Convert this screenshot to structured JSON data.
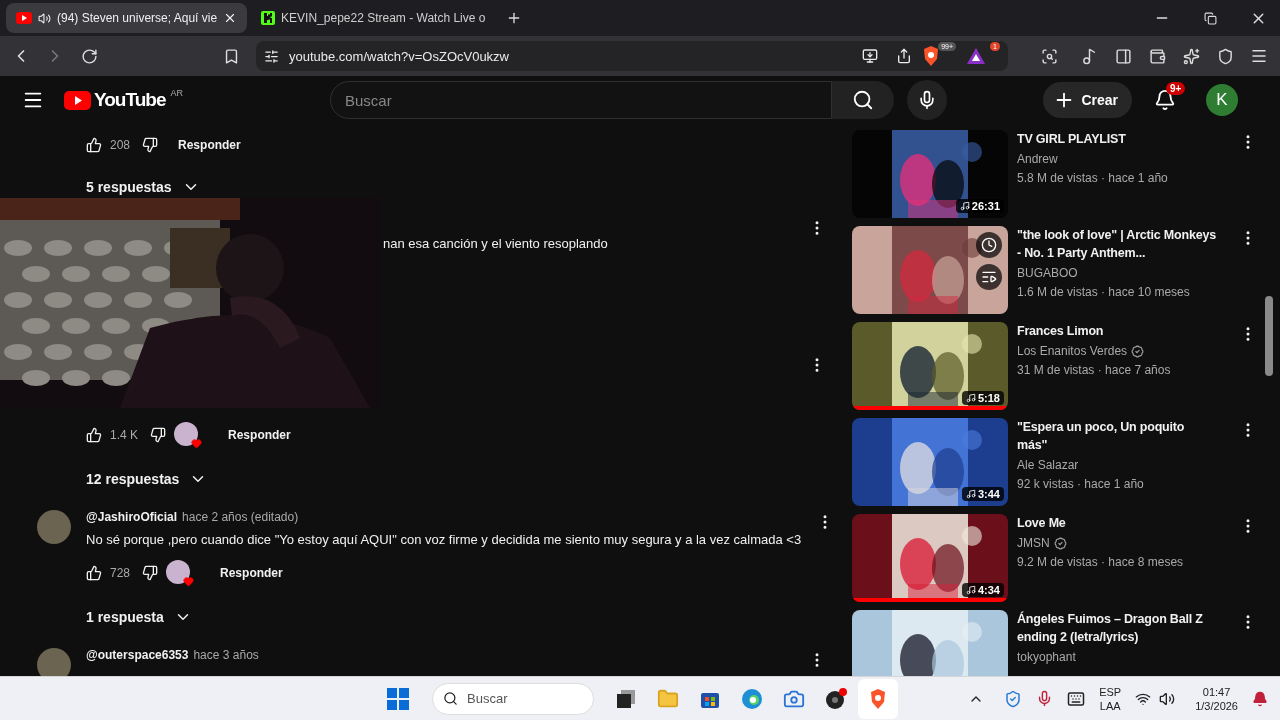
{
  "browser": {
    "tabs": [
      {
        "kind": "play",
        "title": "(94) Steven universe; Aquí vie",
        "selected": true,
        "audio": true
      },
      {
        "kind": "block",
        "title": "KEVIN_pepe22 Stream - Watch Live o",
        "selected": false,
        "audio": false
      }
    ],
    "url": "youtube.com/watch?v=OsZOcV0ukzw",
    "shield_badge": "99+",
    "rewards_badge": "1"
  },
  "header": {
    "logo_text": "YouTube",
    "region": "AR",
    "search_placeholder": "Buscar",
    "create_label": "Crear",
    "notification_count": "9+",
    "avatar_letter": "K"
  },
  "comments": [
    {
      "kind": "actions",
      "likes": "208",
      "creator_heart": false,
      "reply_label": "Responder"
    },
    {
      "kind": "replies",
      "label": "5 respuestas"
    },
    {
      "kind": "fragment",
      "text": "nan esa canción y el viento resoplando"
    },
    {
      "kind": "hidden"
    },
    {
      "kind": "actions",
      "likes": "1.4 K",
      "creator_heart": true,
      "reply_label": "Responder"
    },
    {
      "kind": "replies",
      "label": "12 respuestas"
    },
    {
      "kind": "comment",
      "author": "@JashiroOficial",
      "time": "hace 2 años (editado)",
      "text": "No sé porque ,pero cuando dice \"Yo estoy aquí AQUI\" con voz firme y decidida me siento muy segura y a la vez calmada <3"
    },
    {
      "kind": "actions",
      "likes": "728",
      "creator_heart": true,
      "reply_label": "Responder"
    },
    {
      "kind": "replies",
      "label": "1 respuesta"
    },
    {
      "kind": "comment",
      "author": "@outerspace6353",
      "time": "hace 3 años"
    }
  ],
  "recommendations": [
    {
      "title": "TV GIRL PLAYLIST",
      "channel": "Andrew",
      "verified": false,
      "meta": "5.8 M de vistas · hace 1 año",
      "duration": "26:31",
      "hover": false
    },
    {
      "title": "\"the look of love\" | Arctic Monkeys - No. 1 Party Anthem...",
      "channel": "BUGABOO",
      "verified": false,
      "meta": "1.6 M de vistas · hace 10 meses",
      "hover": true
    },
    {
      "title": "Frances Limon",
      "channel": "Los Enanitos Verdes",
      "verified": true,
      "meta": "31 M de vistas · hace 7 años",
      "duration": "5:18",
      "hover": false,
      "level": 1
    },
    {
      "title": "\"Espera un poco, Un poquito más\"",
      "channel": "Ale Salazar",
      "verified": false,
      "meta": "92 k vistas · hace 1 año",
      "duration": "3:44",
      "hover": false
    },
    {
      "title": "Love Me",
      "channel": "JMSN",
      "verified": true,
      "meta": "9.2 M de vistas · hace 8 meses",
      "duration": "4:34",
      "hover": false,
      "level": 1
    },
    {
      "title": "Ángeles Fuimos – Dragon Ball Z ending 2 (letra/lyrics)",
      "channel": "tokyophant",
      "verified": false,
      "hover": false
    }
  ],
  "taskbar": {
    "search_placeholder": "Buscar",
    "language": "ESP",
    "layout": "LAA",
    "time": "01:47",
    "date": "1/3/2026"
  }
}
